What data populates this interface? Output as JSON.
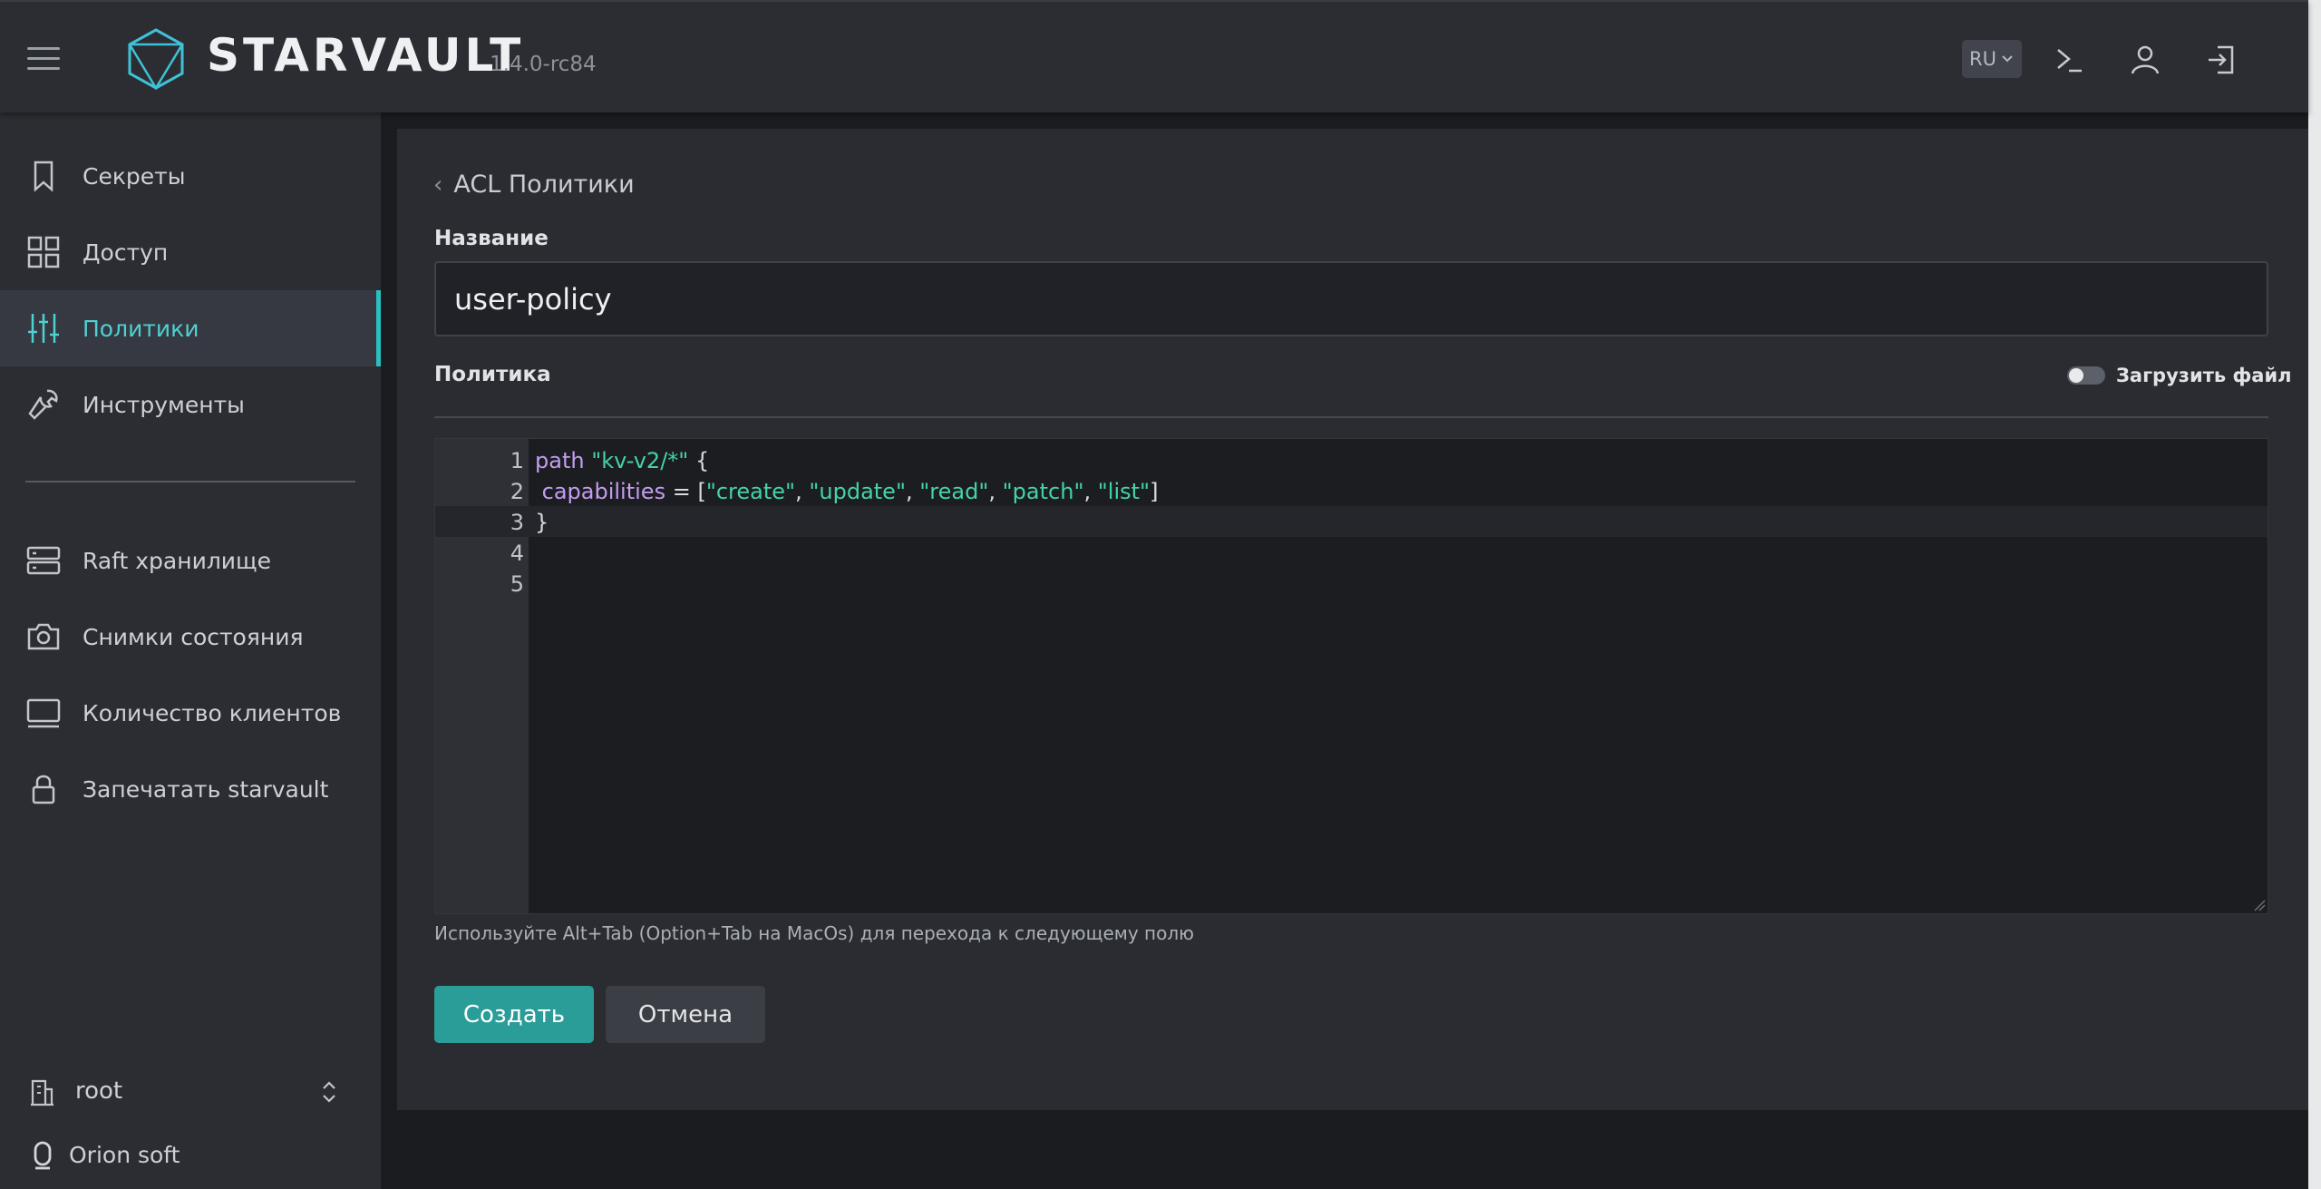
{
  "header": {
    "brand": "STARVAULT",
    "version": "1.4.0-rc84",
    "language": "RU",
    "icons": [
      "terminal-icon",
      "user-icon",
      "logout-icon"
    ]
  },
  "sidebar": {
    "items": [
      {
        "label": "Секреты",
        "icon": "bookmark-icon"
      },
      {
        "label": "Доступ",
        "icon": "grid-icon"
      },
      {
        "label": "Политики",
        "icon": "sliders-icon",
        "active": true
      },
      {
        "label": "Инструменты",
        "icon": "wrench-icon"
      },
      {
        "label": "Raft хранилище",
        "icon": "server-icon"
      },
      {
        "label": "Снимки состояния",
        "icon": "camera-icon"
      },
      {
        "label": "Количество клиентов",
        "icon": "monitor-icon"
      },
      {
        "label": "Запечатать starvault",
        "icon": "lock-icon"
      }
    ],
    "namespace": "root",
    "organization": "Orion soft"
  },
  "main": {
    "breadcrumb": "ACL Политики",
    "name_label": "Название",
    "name_value": "user-policy",
    "policy_label": "Политика",
    "upload_toggle_label": "Загрузить файл",
    "editor": {
      "line_numbers": [
        "1",
        "2",
        "3",
        "4",
        "5"
      ],
      "lines": [
        [
          [
            "kw",
            "path"
          ],
          [
            "plain",
            " "
          ],
          [
            "str",
            "\"kv-v2/*\""
          ],
          [
            "plain",
            " {"
          ]
        ],
        [
          [
            "plain",
            " "
          ],
          [
            "kw",
            "capabilities"
          ],
          [
            "plain",
            " = ["
          ],
          [
            "str",
            "\"create\""
          ],
          [
            "plain",
            ", "
          ],
          [
            "str",
            "\"update\""
          ],
          [
            "plain",
            ", "
          ],
          [
            "str",
            "\"read\""
          ],
          [
            "plain",
            ", "
          ],
          [
            "str",
            "\"patch\""
          ],
          [
            "plain",
            ", "
          ],
          [
            "str",
            "\"list\""
          ],
          [
            "plain",
            "]"
          ]
        ],
        [
          [
            "plain",
            "}"
          ]
        ],
        [],
        []
      ]
    },
    "hint": "Используйте Alt+Tab (Option+Tab на MacOs) для перехода к следующему полю",
    "create_button": "Создать",
    "cancel_button": "Отмена"
  },
  "colors": {
    "accent": "#2ac0c0",
    "primary_button": "#2b9d98",
    "keyword": "#c39df0",
    "string": "#44d3a8"
  }
}
